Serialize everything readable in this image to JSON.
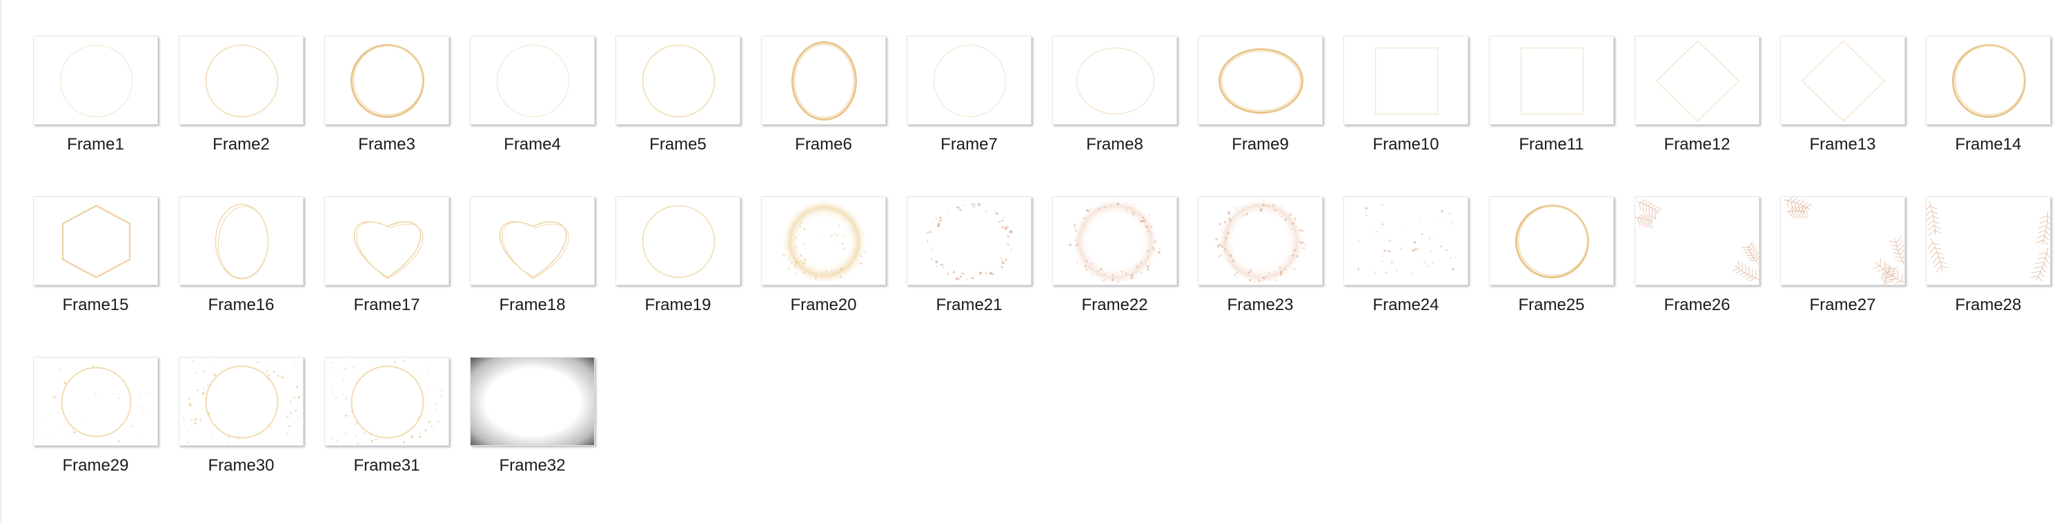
{
  "folder": {
    "items": [
      {
        "name": "Frame1",
        "art": "circle-faint"
      },
      {
        "name": "Frame2",
        "art": "circle-thin"
      },
      {
        "name": "Frame3",
        "art": "circle-bold"
      },
      {
        "name": "Frame4",
        "art": "circle-faint"
      },
      {
        "name": "Frame5",
        "art": "circle-thin"
      },
      {
        "name": "Frame6",
        "art": "oval-bold"
      },
      {
        "name": "Frame7",
        "art": "circle-faint"
      },
      {
        "name": "Frame8",
        "art": "ellipse-thin"
      },
      {
        "name": "Frame9",
        "art": "ellipse-bold"
      },
      {
        "name": "Frame10",
        "art": "square"
      },
      {
        "name": "Frame11",
        "art": "square"
      },
      {
        "name": "Frame12",
        "art": "diamond"
      },
      {
        "name": "Frame13",
        "art": "diamond"
      },
      {
        "name": "Frame14",
        "art": "circle-bold"
      },
      {
        "name": "Frame15",
        "art": "hexagon"
      },
      {
        "name": "Frame16",
        "art": "oval-sketch"
      },
      {
        "name": "Frame17",
        "art": "heart"
      },
      {
        "name": "Frame18",
        "art": "heart"
      },
      {
        "name": "Frame19",
        "art": "circle-thin"
      },
      {
        "name": "Frame20",
        "art": "circle-glow"
      },
      {
        "name": "Frame21",
        "art": "circle-dots"
      },
      {
        "name": "Frame22",
        "art": "circle-speckle"
      },
      {
        "name": "Frame23",
        "art": "circle-speckle"
      },
      {
        "name": "Frame24",
        "art": "confetti"
      },
      {
        "name": "Frame25",
        "art": "circle-bold"
      },
      {
        "name": "Frame26",
        "art": "leaf-corners"
      },
      {
        "name": "Frame27",
        "art": "leaf-corners-2"
      },
      {
        "name": "Frame28",
        "art": "leaf-sides"
      },
      {
        "name": "Frame29",
        "art": "circle-confetti"
      },
      {
        "name": "Frame30",
        "art": "circle-confetti-dense"
      },
      {
        "name": "Frame31",
        "art": "circle-confetti-dense"
      },
      {
        "name": "Frame32",
        "art": "vignette"
      }
    ]
  },
  "colors": {
    "gold": "#e9c48a",
    "gold_light": "#f2dcb3",
    "gold_faint": "#f5e8d2",
    "rose": "#e0b39a",
    "vignette": "#4a4a4a"
  }
}
